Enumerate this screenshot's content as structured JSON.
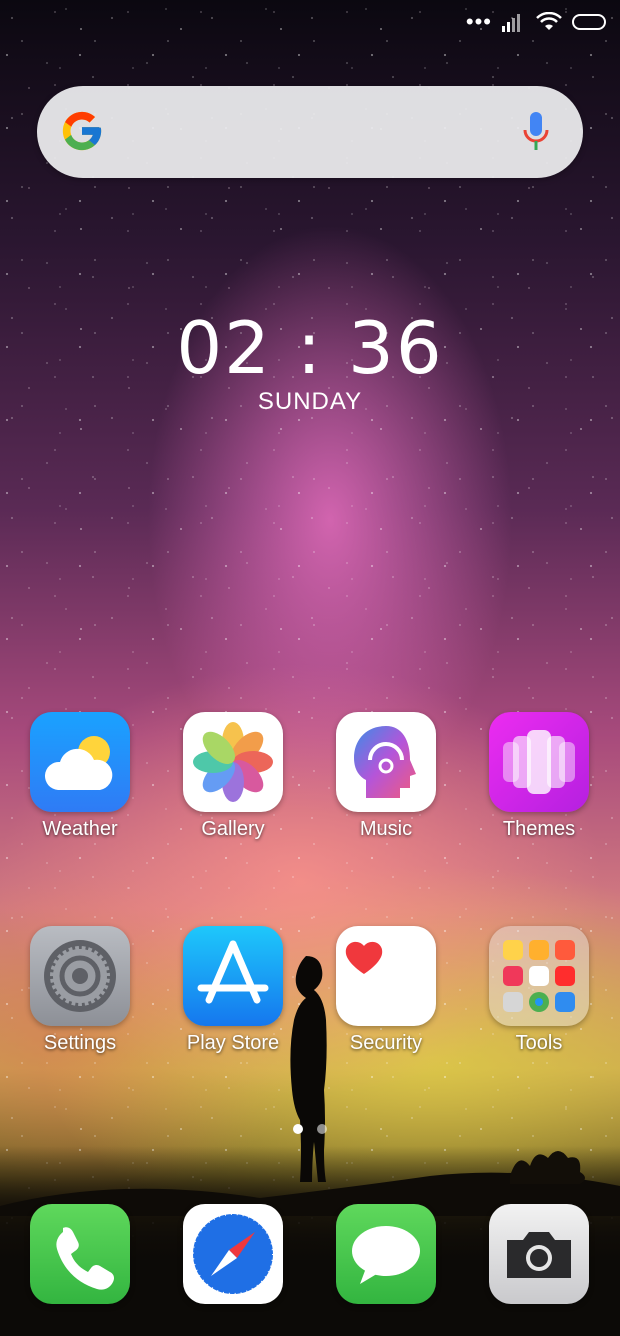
{
  "clock": {
    "time": "02 : 36",
    "day": "SUNDAY"
  },
  "status_bar": {
    "icons": [
      "more-dots-icon",
      "signal-icon",
      "wifi-icon",
      "battery-icon"
    ]
  },
  "search": {
    "logo": "google-g-icon",
    "mic": "mic-icon"
  },
  "apps_row1": [
    {
      "label": "Weather",
      "icon": "weather-icon"
    },
    {
      "label": "Gallery",
      "icon": "gallery-icon"
    },
    {
      "label": "Music",
      "icon": "music-icon"
    },
    {
      "label": "Themes",
      "icon": "themes-icon"
    }
  ],
  "apps_row2": [
    {
      "label": "Settings",
      "icon": "settings-icon"
    },
    {
      "label": "Play Store",
      "icon": "play-store-icon"
    },
    {
      "label": "Security",
      "icon": "security-icon"
    },
    {
      "label": "Tools",
      "icon": "tools-folder-icon"
    }
  ],
  "dock": [
    {
      "icon": "phone-icon"
    },
    {
      "icon": "compass-browser-icon"
    },
    {
      "icon": "messages-icon"
    },
    {
      "icon": "camera-icon"
    }
  ],
  "pager": {
    "pages": 2,
    "current": 1
  }
}
